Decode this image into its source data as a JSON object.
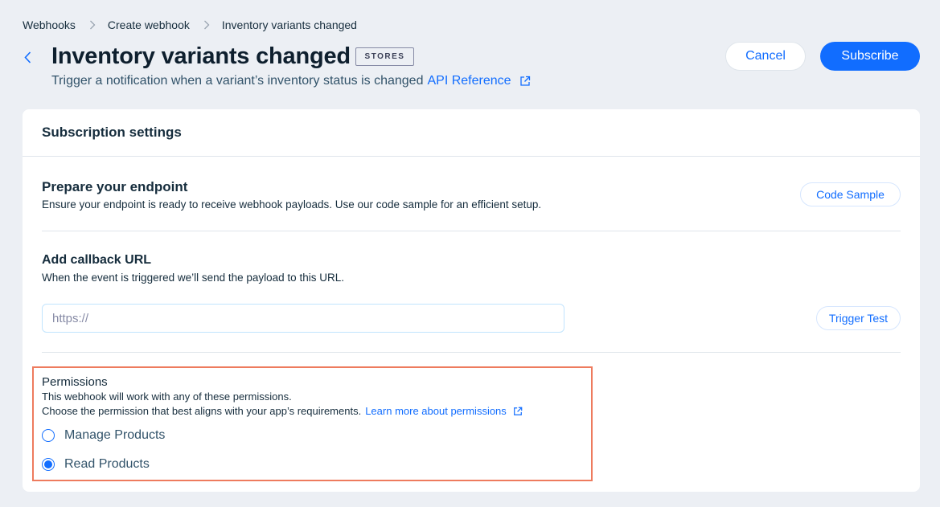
{
  "breadcrumb": {
    "items": [
      "Webhooks",
      "Create webhook",
      "Inventory variants changed"
    ]
  },
  "header": {
    "title": "Inventory variants changed",
    "badge": "STORES",
    "subtitle": "Trigger a notification when a variant’s inventory status is changed",
    "api_link": "API Reference",
    "cancel_label": "Cancel",
    "subscribe_label": "Subscribe"
  },
  "card": {
    "title": "Subscription settings",
    "endpoint": {
      "title": "Prepare your endpoint",
      "description": "Ensure your endpoint is ready to receive webhook payloads. Use our code sample for an efficient setup.",
      "button": "Code Sample"
    },
    "callback": {
      "title": "Add callback URL",
      "description": "When the event is triggered we’ll send the payload to this URL.",
      "placeholder": "https://",
      "value": "",
      "button": "Trigger Test"
    },
    "permissions": {
      "title": "Permissions",
      "line1": "This webhook will work with any of these permissions.",
      "line2": "Choose the permission that best aligns with your app’s requirements.",
      "learn_more": "Learn more about permissions",
      "options": [
        {
          "label": "Manage Products",
          "checked": false
        },
        {
          "label": "Read Products",
          "checked": true
        }
      ]
    }
  },
  "colors": {
    "accent": "#116dff",
    "highlight_border": "#ee7b5e",
    "background": "#eceff4"
  },
  "icons": [
    "chevron-right-icon",
    "back-arrow-icon",
    "external-link-icon",
    "radio-icon"
  ]
}
